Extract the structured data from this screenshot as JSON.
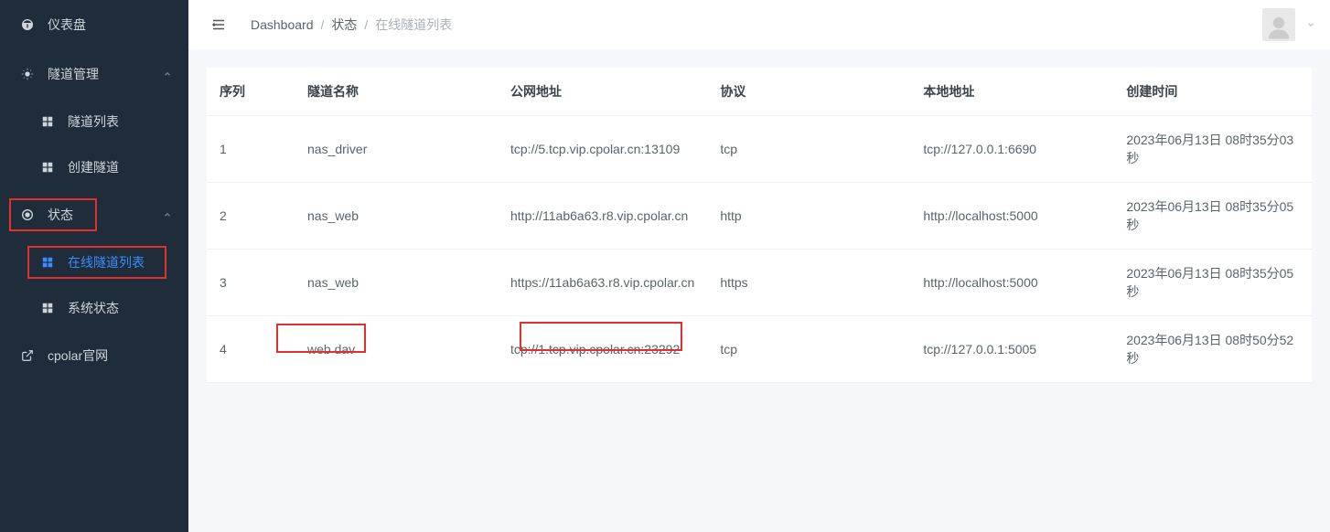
{
  "sidebar": {
    "dashboard": "仪表盘",
    "tunnelMgmt": "隧道管理",
    "tunnelList": "隧道列表",
    "createTunnel": "创建隧道",
    "status": "状态",
    "onlineTunnels": "在线隧道列表",
    "systemStatus": "系统状态",
    "officialSite": "cpolar官网"
  },
  "breadcrumb": {
    "dashboard": "Dashboard",
    "status": "状态",
    "onlineTunnels": "在线隧道列表"
  },
  "table": {
    "headers": {
      "seq": "序列",
      "name": "隧道名称",
      "publicAddr": "公网地址",
      "protocol": "协议",
      "localAddr": "本地地址",
      "createdAt": "创建时间"
    },
    "rows": [
      {
        "seq": "1",
        "name": "nas_driver",
        "publicAddr": "tcp://5.tcp.vip.cpolar.cn:13109",
        "protocol": "tcp",
        "localAddr": "tcp://127.0.0.1:6690",
        "createdAt": "2023年06月13日 08时35分03秒"
      },
      {
        "seq": "2",
        "name": "nas_web",
        "publicAddr": "http://11ab6a63.r8.vip.cpolar.cn",
        "protocol": "http",
        "localAddr": "http://localhost:5000",
        "createdAt": "2023年06月13日 08时35分05秒"
      },
      {
        "seq": "3",
        "name": "nas_web",
        "publicAddr": "https://11ab6a63.r8.vip.cpolar.cn",
        "protocol": "https",
        "localAddr": "http://localhost:5000",
        "createdAt": "2023年06月13日 08时35分05秒"
      },
      {
        "seq": "4",
        "name": "web dav",
        "publicAddr": "tcp://1.tcp.vip.cpolar.cn:23292",
        "protocol": "tcp",
        "localAddr": "tcp://127.0.0.1:5005",
        "createdAt": "2023年06月13日 08时50分52秒"
      }
    ]
  }
}
